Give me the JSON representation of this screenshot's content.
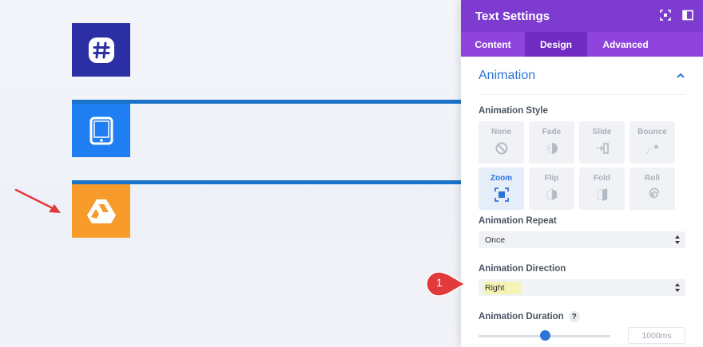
{
  "canvas": {
    "tiles": [
      {
        "name": "slack-tile",
        "icon": "slack-hash-icon",
        "color": "#2b2fa3"
      },
      {
        "name": "tablet-tile",
        "icon": "tablet-icon",
        "color": "#1e7ef2"
      },
      {
        "name": "drive-tile",
        "icon": "google-drive-icon",
        "color": "#f79c2a"
      }
    ],
    "bar_color": "#1a73c8",
    "pointer_arrow_color": "#e23a3a"
  },
  "panel": {
    "title": "Text Settings",
    "header_icons": [
      "fullscreen-icon",
      "sidebar-toggle-icon"
    ],
    "tabs": [
      {
        "label": "Content",
        "active": false
      },
      {
        "label": "Design",
        "active": true
      },
      {
        "label": "Advanced",
        "active": false
      }
    ],
    "group_title": "Animation",
    "animation_style": {
      "label": "Animation Style",
      "options": [
        {
          "label": "None",
          "icon": "none-icon",
          "selected": false
        },
        {
          "label": "Fade",
          "icon": "fade-icon",
          "selected": false
        },
        {
          "label": "Slide",
          "icon": "slide-icon",
          "selected": false
        },
        {
          "label": "Bounce",
          "icon": "bounce-icon",
          "selected": false
        },
        {
          "label": "Zoom",
          "icon": "zoom-icon",
          "selected": true
        },
        {
          "label": "Flip",
          "icon": "flip-icon",
          "selected": false
        },
        {
          "label": "Fold",
          "icon": "fold-icon",
          "selected": false
        },
        {
          "label": "Roll",
          "icon": "roll-icon",
          "selected": false
        }
      ]
    },
    "repeat": {
      "label": "Animation Repeat",
      "value": "Once"
    },
    "direction": {
      "label": "Animation Direction",
      "value": "Right"
    },
    "duration": {
      "label": "Animation Duration",
      "help": "?",
      "value": "1000ms",
      "slider_fraction": 0.55
    },
    "accent_color": "#2e74d8",
    "header_color": "#7e3bd0",
    "tabs_color": "#8e44dd"
  },
  "marker": {
    "number": "1",
    "color": "#e23a3a"
  }
}
